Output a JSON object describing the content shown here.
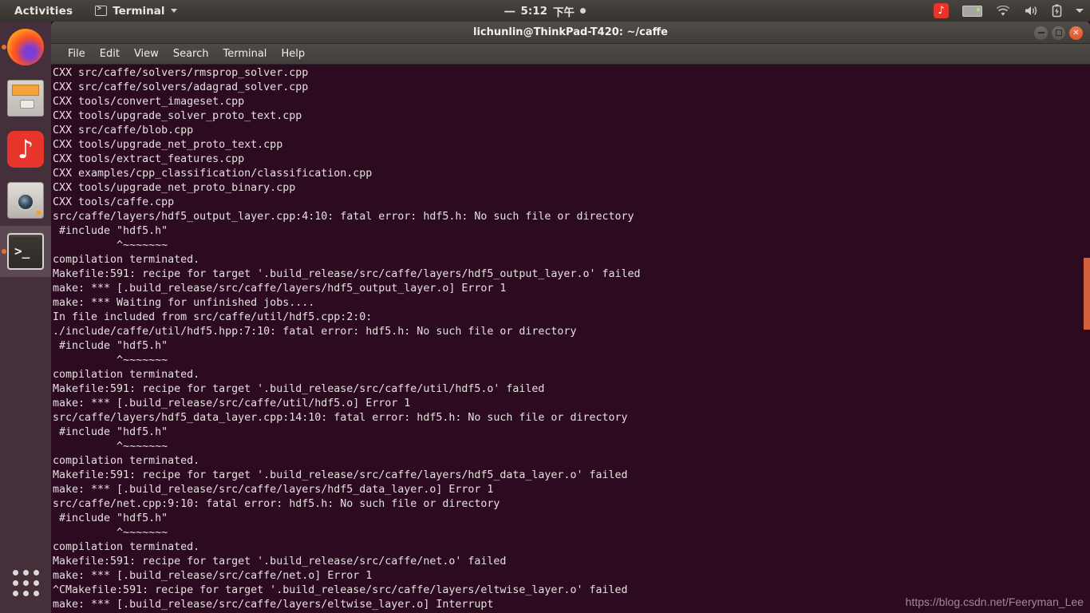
{
  "topbar": {
    "activities": "Activities",
    "app_name": "Terminal",
    "app_icon": "terminal-icon",
    "clock": {
      "day": "一",
      "time": "5:12",
      "meridiem": "下午"
    },
    "tray": [
      {
        "name": "netease-music-icon",
        "glyph": "♪"
      },
      {
        "name": "keyboard-input-icon",
        "glyph": ""
      },
      {
        "name": "wifi-icon",
        "glyph": ""
      },
      {
        "name": "volume-icon",
        "glyph": ""
      },
      {
        "name": "battery-icon",
        "glyph": ""
      },
      {
        "name": "system-menu-caret-icon",
        "glyph": ""
      }
    ]
  },
  "dock": {
    "items": [
      {
        "name": "firefox",
        "label": "Firefox Web Browser",
        "running": true,
        "active": false
      },
      {
        "name": "files",
        "label": "Files",
        "running": false,
        "active": false
      },
      {
        "name": "netease-music",
        "label": "NetEase Cloud Music",
        "running": false,
        "active": false,
        "glyph": "♪"
      },
      {
        "name": "camera",
        "label": "Cheese Camera",
        "running": false,
        "active": false
      },
      {
        "name": "terminal",
        "label": "Terminal",
        "running": true,
        "active": true,
        "glyph": ">_"
      }
    ],
    "show_applications": "Show Applications"
  },
  "window": {
    "title": "lichunlin@ThinkPad-T420: ~/caffe",
    "buttons": {
      "minimize": "−",
      "maximize": "□",
      "close": "✕"
    },
    "menu": [
      "File",
      "Edit",
      "View",
      "Search",
      "Terminal",
      "Help"
    ]
  },
  "terminal": {
    "lines": [
      "CXX src/caffe/solvers/rmsprop_solver.cpp",
      "CXX src/caffe/solvers/adagrad_solver.cpp",
      "CXX tools/convert_imageset.cpp",
      "CXX tools/upgrade_solver_proto_text.cpp",
      "CXX src/caffe/blob.cpp",
      "CXX tools/upgrade_net_proto_text.cpp",
      "CXX tools/extract_features.cpp",
      "CXX examples/cpp_classification/classification.cpp",
      "CXX tools/upgrade_net_proto_binary.cpp",
      "CXX tools/caffe.cpp",
      "src/caffe/layers/hdf5_output_layer.cpp:4:10: fatal error: hdf5.h: No such file or directory",
      " #include \"hdf5.h\"",
      "          ^~~~~~~~",
      "compilation terminated.",
      "Makefile:591: recipe for target '.build_release/src/caffe/layers/hdf5_output_layer.o' failed",
      "make: *** [.build_release/src/caffe/layers/hdf5_output_layer.o] Error 1",
      "make: *** Waiting for unfinished jobs....",
      "In file included from src/caffe/util/hdf5.cpp:2:0:",
      "./include/caffe/util/hdf5.hpp:7:10: fatal error: hdf5.h: No such file or directory",
      " #include \"hdf5.h\"",
      "          ^~~~~~~~",
      "compilation terminated.",
      "Makefile:591: recipe for target '.build_release/src/caffe/util/hdf5.o' failed",
      "make: *** [.build_release/src/caffe/util/hdf5.o] Error 1",
      "src/caffe/layers/hdf5_data_layer.cpp:14:10: fatal error: hdf5.h: No such file or directory",
      " #include \"hdf5.h\"",
      "          ^~~~~~~~",
      "compilation terminated.",
      "Makefile:591: recipe for target '.build_release/src/caffe/layers/hdf5_data_layer.o' failed",
      "make: *** [.build_release/src/caffe/layers/hdf5_data_layer.o] Error 1",
      "src/caffe/net.cpp:9:10: fatal error: hdf5.h: No such file or directory",
      " #include \"hdf5.h\"",
      "          ^~~~~~~~",
      "compilation terminated.",
      "Makefile:591: recipe for target '.build_release/src/caffe/net.o' failed",
      "make: *** [.build_release/src/caffe/net.o] Error 1",
      "^CMakefile:591: recipe for target '.build_release/src/caffe/layers/eltwise_layer.o' failed",
      "make: *** [.build_release/src/caffe/layers/eltwise_layer.o] Interrupt"
    ]
  },
  "watermark": "https://blog.csdn.net/Feeryman_Lee",
  "colors": {
    "terminal_bg": "#2c0a20",
    "topbar_bg": "#403d39",
    "dock_bg": "#452f3a",
    "accent_orange": "#e8702a",
    "scrollbar_thumb": "#d4603a",
    "close_button": "#e0552a"
  }
}
